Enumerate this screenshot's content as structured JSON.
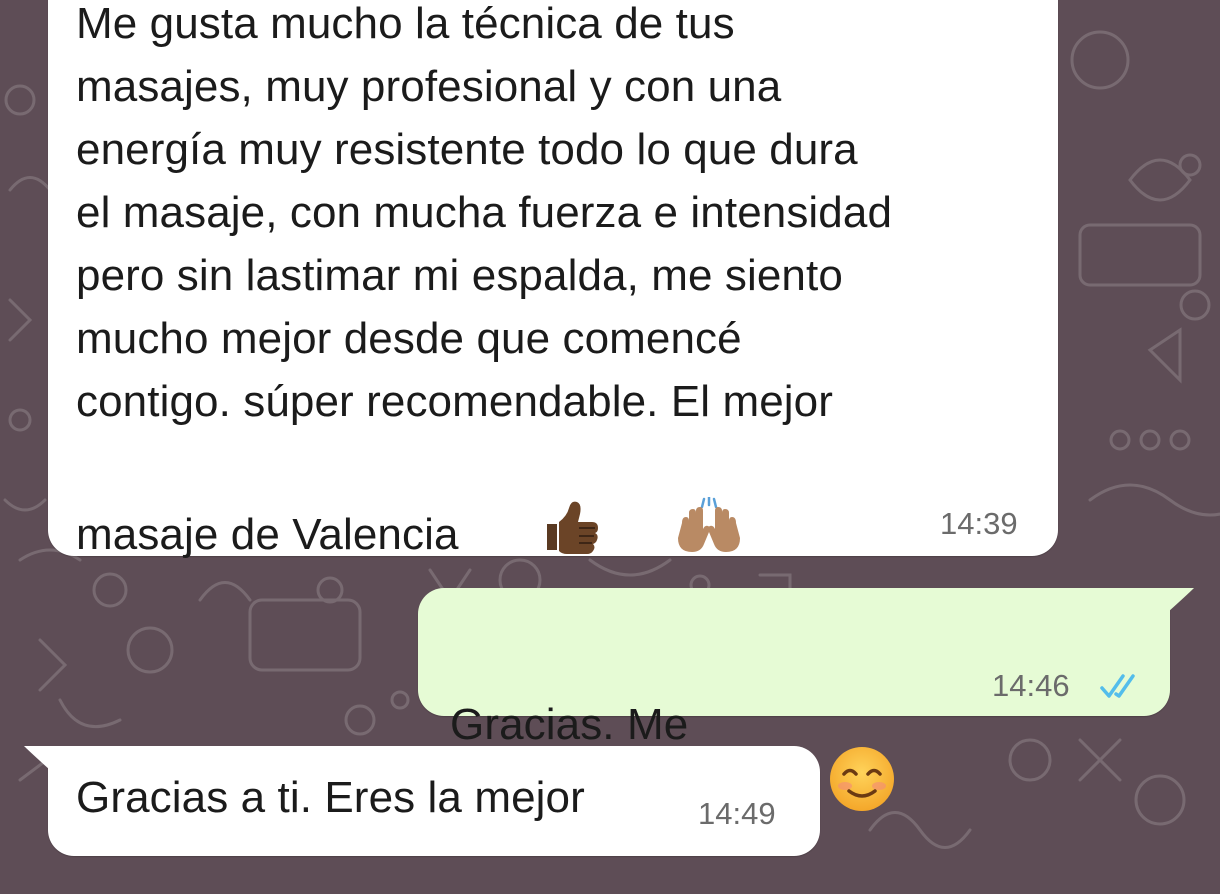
{
  "chat": {
    "messages": [
      {
        "direction": "incoming",
        "text": "Me gusta mucho la técnica de tus\nmasajes, muy profesional y con una\nenergía muy resistente todo lo que dura\nel masaje, con mucha fuerza e intensidad\npero sin lastimar mi espalda, me siento\nmucho mejor desde que comencé\ncontigo. súper recomendable. El mejor",
        "text_last_line": "masaje de Valencia",
        "emojis": [
          "thumbs-up-icon",
          "raising-hands-icon"
        ],
        "time": "14:39"
      },
      {
        "direction": "outgoing",
        "text": "Gracias. Me alegro",
        "emojis": [
          "smiling-face-icon"
        ],
        "time": "14:46",
        "status": "read"
      },
      {
        "direction": "incoming",
        "text": "Gracias a ti. Eres la mejor",
        "time": "14:49"
      }
    ]
  },
  "colors": {
    "wallpaper": "#5e4d56",
    "incoming_bubble": "#ffffff",
    "outgoing_bubble": "#e6fbd5",
    "read_ticks": "#53bdeb",
    "timestamp": "#6b6b6b"
  }
}
